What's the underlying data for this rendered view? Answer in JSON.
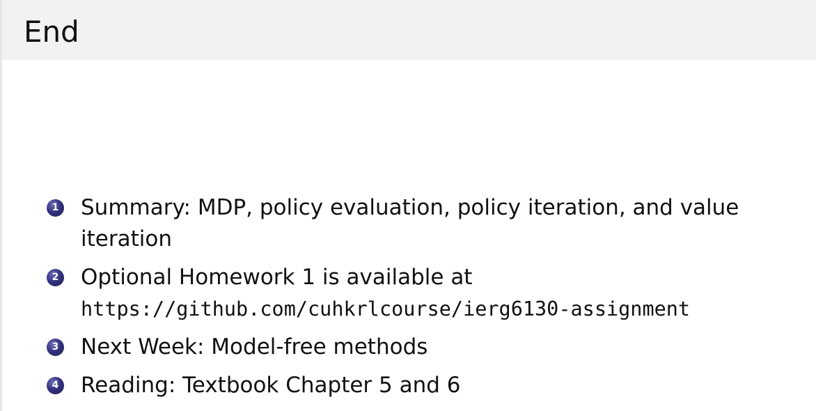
{
  "slide": {
    "title": "End",
    "items": [
      {
        "number": "1",
        "text": "Summary: MDP, policy evaluation, policy iteration, and value iteration"
      },
      {
        "number": "2",
        "text": "Optional Homework 1 is available at",
        "link": "https://github.com/cuhkrlcourse/ierg6130-assignment"
      },
      {
        "number": "3",
        "text": "Next Week: Model-free methods"
      },
      {
        "number": "4",
        "text": "Reading: Textbook Chapter 5 and 6"
      }
    ]
  }
}
